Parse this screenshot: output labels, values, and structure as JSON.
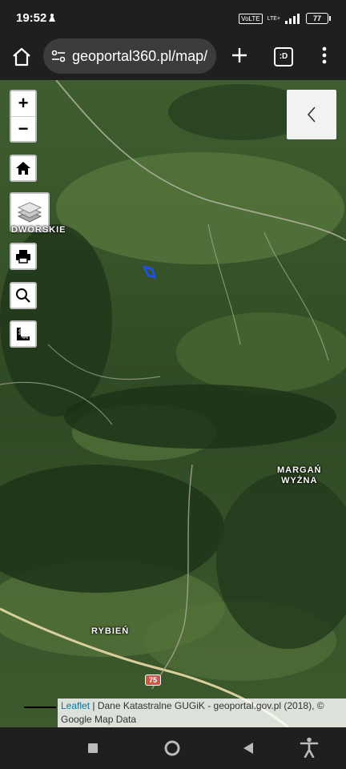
{
  "status": {
    "time": "19:52",
    "volte": "VoLTE",
    "network": "LTE+",
    "battery": "77"
  },
  "browser": {
    "url": "geoportal360.pl/map/",
    "tabs_label": ":D"
  },
  "map": {
    "controls": {
      "zoom_in": "+",
      "zoom_out": "−"
    },
    "labels": {
      "dworskie": "DWORSKIE",
      "margan_1": "MARGAŃ",
      "margan_2": "WYŻNA",
      "rybien": "RYBIEŃ",
      "road": "75"
    },
    "attribution": {
      "leaflet": "Leaflet",
      "text": " | Dane Katastralne GUGiK - geoportal.gov.pl (2018), © Google Map Data"
    }
  },
  "colors": {
    "bar_bg": "#1f1f1f",
    "url_bg": "#3c3c3c",
    "road_badge": "#c95b4a",
    "parcel": "#1e4fff"
  }
}
